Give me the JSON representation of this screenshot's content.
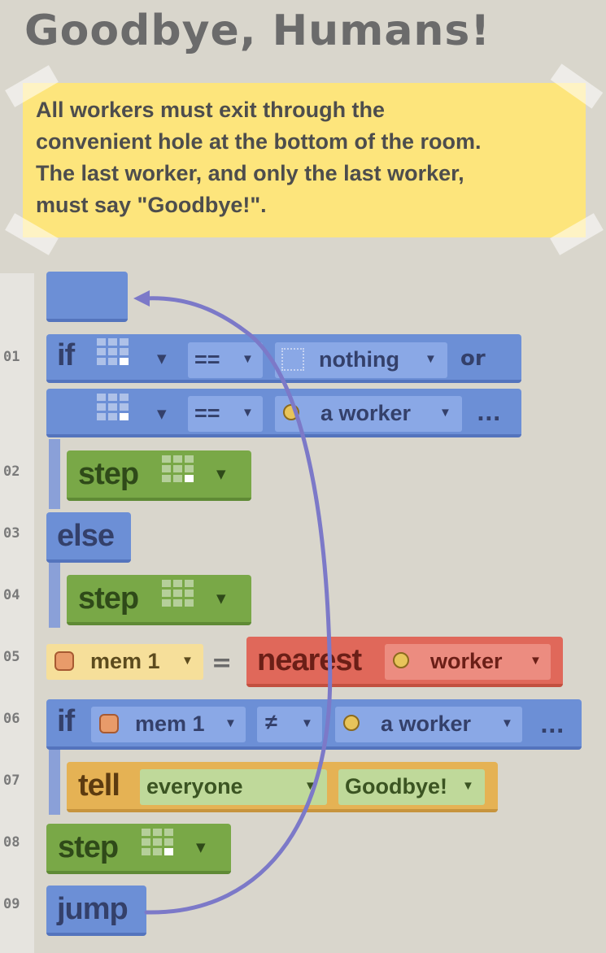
{
  "title": "Goodbye, Humans!",
  "note": "All workers must exit through the\nconvenient hole at the bottom of the room.\nThe last worker, and only the last worker,\nmust say \"Goodbye!\".",
  "line_numbers": [
    "01",
    "02",
    "03",
    "04",
    "05",
    "06",
    "07",
    "08",
    "09"
  ],
  "program": {
    "if_kw": "if",
    "or_kw": "or",
    "eq": "==",
    "neq": "≠",
    "equals_assign": "=",
    "nothing": "nothing",
    "a_worker": "a worker",
    "more": "...",
    "step_kw": "step",
    "else_kw": "else",
    "mem1": "mem 1",
    "nearest_kw": "nearest",
    "worker": "worker",
    "tell_kw": "tell",
    "everyone": "everyone",
    "goodbye": "Goodbye!",
    "jump_kw": "jump",
    "dropdown_glyph": "▼"
  },
  "icons": {
    "dir_grid": "direction-grid-icon",
    "empty": "empty-square-icon",
    "worker": "worker-head-icon",
    "mem": "memory-barrel-icon",
    "arrow": "jump-arrow"
  },
  "colors": {
    "blue": "#6c8fd6",
    "green": "#79a847",
    "red": "#e0685a",
    "orange": "#e5b254",
    "note": "#fde57c",
    "arrow": "#7c79c8"
  }
}
